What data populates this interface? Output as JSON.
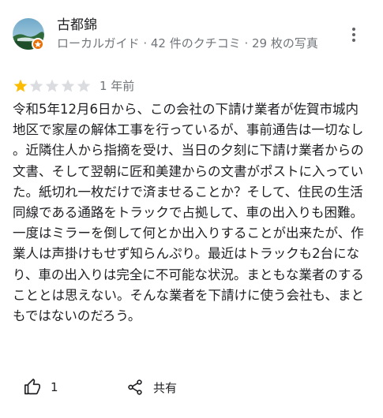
{
  "reviewer": {
    "name": "古都錦",
    "meta": "ローカルガイド · 42 件のクチコミ · 29 枚の写真",
    "avatar_icon": "profile-photo-landscape",
    "badge_icon": "local-guide-star-icon",
    "badge_color": "#e8710a"
  },
  "rating": {
    "stars": 1,
    "out_of": 5,
    "time": "1 年前",
    "filled_color": "#fbbc04",
    "empty_color": "#dadce0"
  },
  "review": {
    "text": "令和5年12月6日から、この会社の下請け業者が佐賀市城内地区で家屋の解体工事を行っているが、事前通告は一切なし。近隣住人から指摘を受け、当日の夕刻に下請け業者からの文書、そして翌朝に匠和美建からの文書がポストに入っていた。紙切れ一枚だけで済ませることか？そして、住民の生活同線である通路をトラックで占拠して、車の出入りも困難。一度はミラーを倒して何とか出入りすることが出来たが、作業人は声掛けもせず知らんぷり。最近はトラックも2台になり、車の出入りは完全に不可能な状況。まともな業者のすることとは思えない。そんな業者を下請けに使う会社も、まともではないのだろう。"
  },
  "actions": {
    "like_count": "1",
    "like_icon": "thumb-up-icon",
    "share_label": "共有",
    "share_icon": "share-icon",
    "more_icon": "more-vert-icon"
  }
}
